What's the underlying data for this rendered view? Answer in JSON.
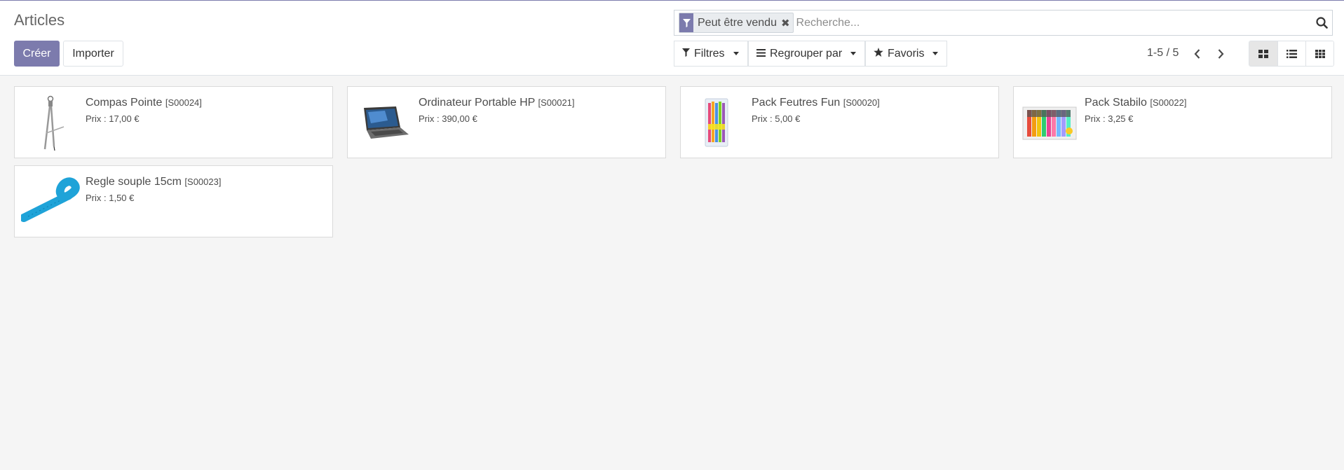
{
  "header": {
    "title": "Articles",
    "create_label": "Créer",
    "import_label": "Importer"
  },
  "search": {
    "facet_label": "Peut être vendu",
    "placeholder": "Recherche...",
    "facet_color": "#7c7bad"
  },
  "filters": {
    "filters_label": "Filtres",
    "group_by_label": "Regrouper par",
    "favorites_label": "Favoris"
  },
  "pager": {
    "value": "1-5 / 5"
  },
  "views": {
    "active": "kanban",
    "items": [
      "kanban",
      "list",
      "grid"
    ]
  },
  "products": [
    {
      "name": "Compas Pointe",
      "ref": "[S00024]",
      "price": "Prix : 17,00 €",
      "icon": "compass-image"
    },
    {
      "name": "Ordinateur Portable HP",
      "ref": "[S00021]",
      "price": "Prix : 390,00 €",
      "icon": "laptop-image"
    },
    {
      "name": "Pack Feutres Fun",
      "ref": "[S00020]",
      "price": "Prix : 5,00 €",
      "icon": "markers-pack-image"
    },
    {
      "name": "Pack Stabilo",
      "ref": "[S00022]",
      "price": "Prix : 3,25 €",
      "icon": "highlighters-pack-image"
    },
    {
      "name": "Regle souple 15cm",
      "ref": "[S00023]",
      "price": "Prix : 1,50 €",
      "icon": "ruler-image"
    }
  ],
  "colors": {
    "primary": "#7c7bad",
    "background": "#f5f5f5"
  }
}
